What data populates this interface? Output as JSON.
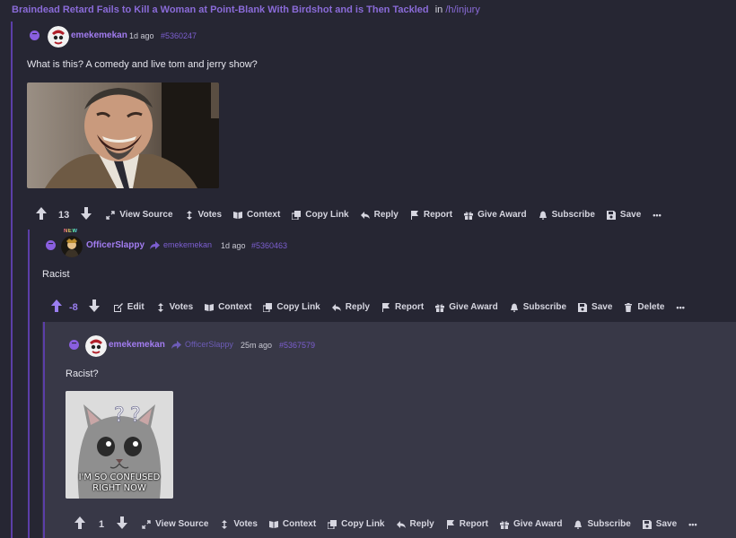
{
  "post": {
    "title": "Braindead Retard Fails to Kill a Woman at Point-Blank With Birdshot and is Then Tackled",
    "in_text": "in",
    "sub": "/h/injury"
  },
  "comments": [
    {
      "collapse": "−",
      "author": "emekemekan",
      "time": "1d ago",
      "id": "#5360247",
      "body": "What is this? A comedy and live tom and jerry show?",
      "score": "13",
      "actions": {
        "view_source": "View Source",
        "votes": "Votes",
        "context": "Context",
        "copy_link": "Copy Link",
        "reply": "Reply",
        "report": "Report",
        "give_award": "Give Award",
        "subscribe": "Subscribe",
        "save": "Save",
        "more": "•••"
      }
    },
    {
      "collapse": "−",
      "badge": "NEW",
      "author": "OfficerSlappy",
      "reply_to": "emekemekan",
      "time": "1d ago",
      "id": "#5360463",
      "body": "Racist",
      "score": "-8",
      "actions": {
        "edit": "Edit",
        "votes": "Votes",
        "context": "Context",
        "copy_link": "Copy Link",
        "reply": "Reply",
        "report": "Report",
        "give_award": "Give Award",
        "subscribe": "Subscribe",
        "save": "Save",
        "delete": "Delete",
        "more": "•••"
      }
    },
    {
      "collapse": "−",
      "author": "emekemekan",
      "reply_to": "OfficerSlappy",
      "time": "25m ago",
      "id": "#5367579",
      "body": "Racist?",
      "image_caption_1": "I'M SO CONFUSED",
      "image_caption_2": "RIGHT NOW",
      "score": "1",
      "actions": {
        "view_source": "View Source",
        "votes": "Votes",
        "context": "Context",
        "copy_link": "Copy Link",
        "reply": "Reply",
        "report": "Report",
        "give_award": "Give Award",
        "subscribe": "Subscribe",
        "save": "Save",
        "more": "•••"
      }
    }
  ],
  "colors": {
    "background": "#262633",
    "nested_background": "#383847",
    "accent": "#8a6bd8",
    "thread_line": "#5b3ea8"
  }
}
